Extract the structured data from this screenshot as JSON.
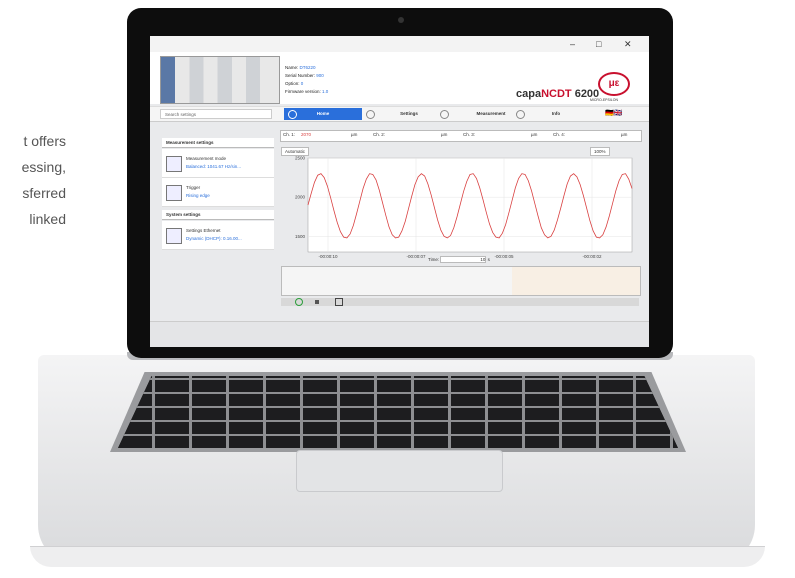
{
  "side_text": [
    "t offers",
    "essing,",
    "sferred",
    "linked"
  ],
  "window": {
    "minimize": "–",
    "maximize": "□",
    "close": "✕"
  },
  "device": {
    "name_label": "Name:",
    "name_value": "DT6220",
    "serial_label": "Serial Number:",
    "serial_value": "900",
    "option_label": "Option:",
    "option_value": "0",
    "firmware_label": "Firmware version:",
    "firmware_value": "1.0"
  },
  "product": {
    "prefix": "capa",
    "highlight": "NCDT",
    "model": " 6200"
  },
  "logo": {
    "mark": "με",
    "text": "MICRO-EPSILON"
  },
  "search": {
    "placeholder": "Search settings"
  },
  "nav": {
    "tabs": [
      {
        "label": "Home",
        "active": true
      },
      {
        "label": "Settings",
        "active": false
      },
      {
        "label": "Measurement",
        "active": false
      },
      {
        "label": "Info",
        "active": false
      }
    ],
    "flags": "🇩🇪🇬🇧"
  },
  "measurement_settings": {
    "title": "Measurement settings",
    "items": [
      {
        "label": "Measurement mode",
        "value": "Balanced: 1041.67 Hz/sin..."
      },
      {
        "label": "Trigger",
        "value": "Rising edge"
      }
    ]
  },
  "system_settings": {
    "title": "System settings",
    "items": [
      {
        "label": "Settings Ethernet",
        "value": "Dynamic (DHCP): 0.16.00..."
      }
    ]
  },
  "channels": [
    {
      "label": "Ch. 1:",
      "value": "2070",
      "unit": "µm"
    },
    {
      "label": "Ch. 2:",
      "value": "",
      "unit": "µm"
    },
    {
      "label": "Ch. 3:",
      "value": "",
      "unit": "µm"
    },
    {
      "label": "Ch. 4:",
      "value": "",
      "unit": "µm"
    }
  ],
  "scaling": {
    "mode": "Automatic",
    "zoom": "100%"
  },
  "time": {
    "label": "Time:",
    "value": "10",
    "unit": "s"
  },
  "chart_data": {
    "type": "line",
    "title": "",
    "xlabel": "",
    "ylabel": "",
    "ylim": [
      1300,
      2500
    ],
    "yticks": [
      "2500",
      "2000",
      "1500"
    ],
    "xticks": [
      "-00:00:10",
      "-00:00:07",
      "-00:00:05",
      "-00:00:02"
    ],
    "series": [
      {
        "color": "#d94040",
        "x": [
          0,
          0.4,
          0.8,
          1.2,
          1.6,
          2,
          2.4,
          2.8,
          3.2,
          3.6,
          4,
          4.4,
          4.8,
          5.2,
          5.6,
          6,
          6.4,
          6.8,
          7.2,
          7.6,
          8,
          8.4,
          8.8,
          9.2,
          9.6,
          10,
          10.4,
          10.8,
          11.2,
          11.6,
          12,
          12.4,
          12.8,
          13.2,
          13.6,
          14,
          14.4,
          14.8,
          15.2,
          15.6,
          16,
          16.4,
          16.8,
          17.2,
          17.6,
          18,
          18.4,
          18.8,
          19.2,
          19.6,
          20,
          20.4,
          20.8,
          21.2,
          21.6,
          22,
          22.4,
          22.8,
          23.2,
          23.6,
          24,
          24.4,
          24.8,
          25.2,
          25.6,
          26,
          26.4,
          26.8,
          27.2,
          27.6,
          28,
          28.4,
          28.8,
          29.2,
          29.6,
          30,
          30.4,
          30.8,
          31.2,
          31.6,
          32,
          32.4,
          32.8,
          33.2,
          33.6,
          34,
          34.4,
          34.8,
          35.2,
          35.6,
          36,
          36.4,
          36.8,
          37.2,
          37.6,
          38,
          38.4,
          38.8,
          39.2,
          39.6,
          40
        ],
        "y": [
          1900,
          2050,
          2190,
          2280,
          2300,
          2250,
          2140,
          1990,
          1830,
          1680,
          1560,
          1490,
          1480,
          1530,
          1640,
          1790,
          1950,
          2110,
          2230,
          2300,
          2290,
          2220,
          2090,
          1930,
          1770,
          1620,
          1520,
          1480,
          1490,
          1570,
          1690,
          1850,
          2010,
          2160,
          2260,
          2300,
          2270,
          2170,
          2030,
          1870,
          1710,
          1580,
          1500,
          1480,
          1510,
          1610,
          1750,
          1910,
          2070,
          2200,
          2290,
          2300,
          2240,
          2120,
          1970,
          1810,
          1660,
          1550,
          1490,
          1480,
          1540,
          1650,
          1800,
          1960,
          2120,
          2240,
          2300,
          2290,
          2210,
          2080,
          1920,
          1760,
          1610,
          1520,
          1480,
          1500,
          1580,
          1710,
          1860,
          2020,
          2170,
          2270,
          2300,
          2260,
          2160,
          2020,
          1860,
          1700,
          1570,
          1490,
          1480,
          1520,
          1620,
          1760,
          1920,
          2080,
          2210,
          2290,
          2300,
          2230,
          2110
        ]
      }
    ],
    "grid": true
  }
}
